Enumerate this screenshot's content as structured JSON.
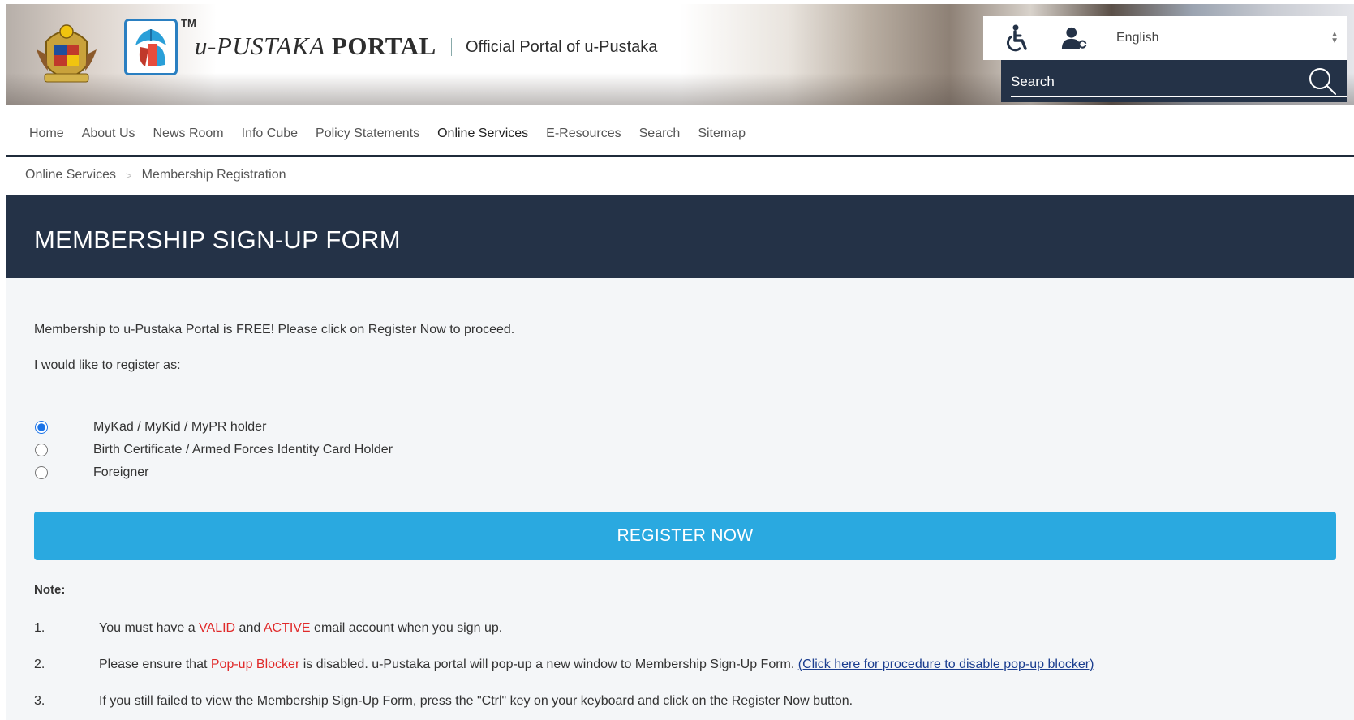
{
  "header": {
    "tm": "TM",
    "portal_title_u": "u-PUSTAKA",
    "portal_title_portal": "PORTAL",
    "subtitle": "Official Portal of u-Pustaka",
    "icons": [
      "crest-icon",
      "u-pustaka-logo-icon",
      "wheelchair-icon",
      "user-key-icon",
      "search-icon"
    ],
    "language": "English",
    "search_placeholder": "Search"
  },
  "nav": {
    "items": [
      "Home",
      "About Us",
      "News Room",
      "Info Cube",
      "Policy Statements",
      "Online Services",
      "E-Resources",
      "Search",
      "Sitemap"
    ],
    "active": "Online Services"
  },
  "breadcrumb": {
    "parent": "Online Services",
    "current": "Membership Registration"
  },
  "page": {
    "title": "MEMBERSHIP SIGN-UP FORM",
    "intro": "Membership to u-Pustaka Portal is FREE! Please click on Register Now to proceed.",
    "register_as": "I would like to register as:",
    "options": [
      {
        "label": "MyKad / MyKid / MyPR holder",
        "selected": true
      },
      {
        "label": "Birth Certificate / Armed Forces Identity Card Holder",
        "selected": false
      },
      {
        "label": "Foreigner",
        "selected": false
      }
    ],
    "register_button": "REGISTER NOW",
    "note_label": "Note:",
    "notes": {
      "n1_num": "1.",
      "n1_a": "You must have a ",
      "n1_valid": "VALID",
      "n1_b": " and ",
      "n1_active": "ACTIVE",
      "n1_c": " email account when you sign up.",
      "n2_num": "2.",
      "n2_a": "Please ensure that ",
      "n2_blocker": "Pop-up Blocker",
      "n2_b": " is disabled. u-Pustaka portal will pop-up a new window to Membership Sign-Up Form. ",
      "n2_link": "(Click here for procedure to disable pop-up blocker)",
      "n3_num": "3.",
      "n3_text": "If you still failed to view the Membership Sign-Up Form, press the \"Ctrl\" key on your keyboard and click on the Register Now button."
    }
  },
  "colors": {
    "navy": "#243247",
    "button_blue": "#2aa9e0",
    "warning_red": "#e02a2a",
    "link_blue": "#1a3d8f"
  }
}
